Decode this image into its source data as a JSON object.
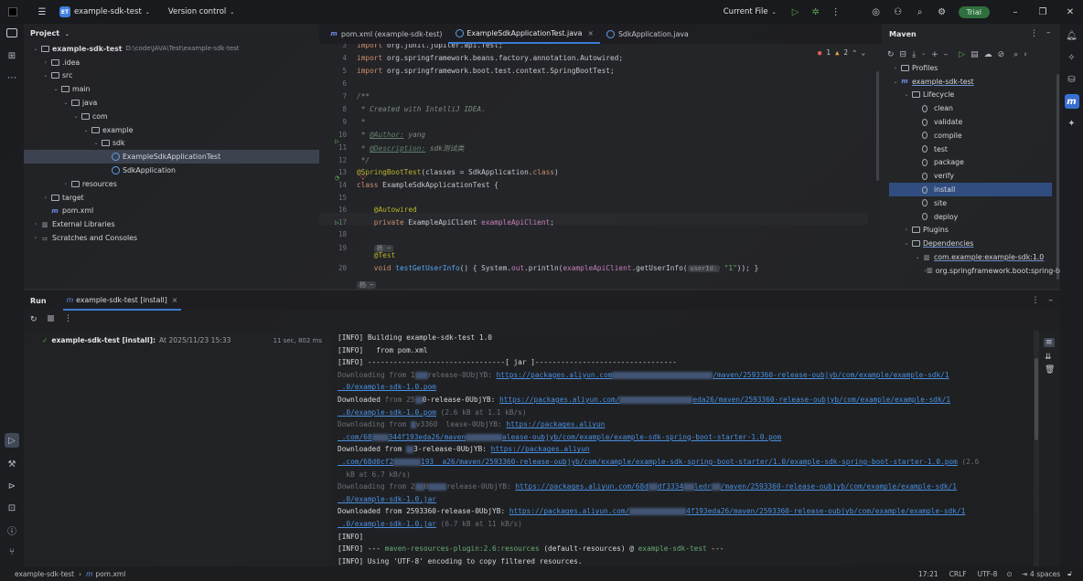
{
  "titlebar": {
    "project_badge": "ET",
    "project_name": "example-sdk-test",
    "vcs": "Version control",
    "run_config": "Current File",
    "trial": "Trial"
  },
  "project_panel": {
    "title": "Project",
    "items": [
      {
        "label": "example-sdk-test",
        "extra": "D:\\code\\JAVA\\Test\\example-sdk-test",
        "chev": "v",
        "icon": "folder",
        "bold": true
      },
      {
        "label": ".idea",
        "chev": ">",
        "icon": "folder"
      },
      {
        "label": "src",
        "chev": "v",
        "icon": "folder"
      },
      {
        "label": "main",
        "chev": "v",
        "icon": "folder"
      },
      {
        "label": "java",
        "chev": "v",
        "icon": "folder"
      },
      {
        "label": "com",
        "chev": "v",
        "icon": "folder"
      },
      {
        "label": "example",
        "chev": "v",
        "icon": "folder"
      },
      {
        "label": "sdk",
        "chev": "v",
        "icon": "folder"
      },
      {
        "label": "ExampleSdkApplicationTest",
        "chev": "",
        "icon": "java",
        "selected": true
      },
      {
        "label": "SdkApplication",
        "chev": "",
        "icon": "java"
      },
      {
        "label": "resources",
        "chev": ">",
        "icon": "folder"
      },
      {
        "label": "target",
        "chev": ">",
        "icon": "folder"
      },
      {
        "label": "pom.xml",
        "chev": "",
        "icon": "maven"
      },
      {
        "label": "External Libraries",
        "chev": ">",
        "icon": "lib"
      },
      {
        "label": "Scratches and Consoles",
        "chev": ">",
        "icon": "scratch"
      }
    ]
  },
  "editor": {
    "tabs": [
      {
        "label": "pom.xml (example-sdk-test)",
        "icon": "m"
      },
      {
        "label": "ExampleSdkApplicationTest.java",
        "icon": "java",
        "active": true,
        "close": "×"
      },
      {
        "label": "SdkApplication.java",
        "icon": "java"
      }
    ],
    "inspections": {
      "errors": "1",
      "warnings": "2"
    },
    "lines": [
      {
        "n": "3",
        "kw": "import ",
        "rest": "org.junit.jupiter.api.Test;"
      },
      {
        "n": "4",
        "kw": "import ",
        "rest": "org.springframework.beans.factory.annotation.Autowired;"
      },
      {
        "n": "5",
        "kw": "import ",
        "rest": "org.springframework.boot.test.context.SpringBootTest;"
      },
      {
        "n": "6",
        "kw": "",
        "rest": ""
      },
      {
        "n": "7",
        "kw": "",
        "rest": "/**",
        "cls": "cm"
      },
      {
        "n": "8",
        "kw": "",
        "rest": " * Created with IntelliJ IDEA.",
        "cls": "cm"
      },
      {
        "n": "9",
        "kw": "",
        "rest": " *",
        "cls": "cm"
      },
      {
        "n": "10",
        "kw": "",
        "rest": " * ",
        "cls": "cm",
        "tag": "@Author:",
        "tagval": " yang"
      },
      {
        "n": "11",
        "kw": "",
        "rest": " * ",
        "cls": "cm",
        "tag": "@Description:",
        "tagval": " sdk测试类"
      },
      {
        "n": "12",
        "kw": "",
        "rest": " */",
        "cls": "cm"
      },
      {
        "n": "13",
        "ann": "@SpringBootTest",
        "rest": "(classes = SdkApplication.",
        "kw2": "class",
        "rest2": ")"
      },
      {
        "n": "14",
        "kw": "class ",
        "rest": "ExampleSdkApplicationTest {"
      },
      {
        "n": "15",
        "kw": "",
        "rest": ""
      },
      {
        "n": "16",
        "ann": "    @Autowired",
        "rest": ""
      },
      {
        "n": "17",
        "kw": "    private ",
        "rest": "ExampleApiClient ",
        "fld": "exampleApiClient",
        "rest2": ";"
      },
      {
        "n": "18",
        "kw": "",
        "rest": ""
      },
      {
        "n": "19",
        "kw": "",
        "rest": "    ",
        "hintline": "杨 ~"
      },
      {
        "n": "",
        "ann": "    @Test",
        "rest": ""
      },
      {
        "n": "20",
        "kw": "    void ",
        "fn": "testGetUserInfo",
        "rest": "() { System.",
        "fld": "out",
        "rest2": ".println(",
        "fld2": "exampleApiClient",
        "rest3": ".getUserInfo(",
        "hint": "userId:",
        "str": " \"1\"",
        "rest4": ")); }"
      },
      {
        "n": "",
        "kw": "",
        "rest": "",
        "hintline": "杨 ~"
      }
    ]
  },
  "maven": {
    "title": "Maven",
    "items": [
      {
        "label": "Profiles",
        "chev": ">",
        "icon": "folder",
        "indent": 0
      },
      {
        "label": "example-sdk-test",
        "chev": "v",
        "icon": "m",
        "indent": 0,
        "underline": true
      },
      {
        "label": "Lifecycle",
        "chev": "v",
        "icon": "folder",
        "indent": 1
      },
      {
        "label": "clean",
        "icon": "gear",
        "indent": 2
      },
      {
        "label": "validate",
        "icon": "gear",
        "indent": 2
      },
      {
        "label": "compile",
        "icon": "gear",
        "indent": 2
      },
      {
        "label": "test",
        "icon": "gear",
        "indent": 2
      },
      {
        "label": "package",
        "icon": "gear",
        "indent": 2
      },
      {
        "label": "verify",
        "icon": "gear",
        "indent": 2
      },
      {
        "label": "install",
        "icon": "gear",
        "indent": 2,
        "selected": true
      },
      {
        "label": "site",
        "icon": "gear",
        "indent": 2
      },
      {
        "label": "deploy",
        "icon": "gear",
        "indent": 2
      },
      {
        "label": "Plugins",
        "chev": ">",
        "icon": "folder",
        "indent": 1
      },
      {
        "label": "Dependencies",
        "chev": "v",
        "icon": "folder",
        "indent": 1,
        "underline": true
      },
      {
        "label": "com.example:example-sdk:1.0",
        "chev": "v",
        "icon": "lib",
        "indent": 2,
        "underline": true
      },
      {
        "label": "org.springframework.boot:spring-b",
        "chev": ">",
        "icon": "lib",
        "indent": 3
      }
    ]
  },
  "run": {
    "title": "Run",
    "tab": "example-sdk-test [install]",
    "tree_item": "example-sdk-test [install]:",
    "tree_time": "At 2025/11/23 15:33",
    "duration": "11 sec, 802 ms",
    "console": [
      [
        {
          "t": "[INFO] Building example-sdk-test 1.0"
        }
      ],
      [
        {
          "t": "[INFO]   from pom.xml"
        }
      ],
      [
        {
          "t": "[INFO] --------------------------------[ jar ]---------------------------------"
        }
      ],
      [
        {
          "t": "Downloading from 1",
          "c": "dim"
        },
        {
          "b": 14
        },
        {
          "t": "release-0UbjYB: ",
          "c": "dim"
        },
        {
          "t": "https://packages.aliyun.com",
          "c": "lnk"
        },
        {
          "b": 110
        },
        {
          "t": "/maven/2593360-release-oubjyb/com/example/example-sdk/1",
          "c": "lnk"
        }
      ],
      [
        {
          "t": " .0/example-sdk-1.0.pom",
          "c": "lnk"
        }
      ],
      [
        {
          "t": "Downloaded "
        },
        {
          "t": "from 25",
          "c": "dim"
        },
        {
          "b": 8
        },
        {
          "t": "0-release-0UbjYB: "
        },
        {
          "t": "https://packages.aliyun.com/",
          "c": "lnk"
        },
        {
          "b": 80
        },
        {
          "t": "eda26/maven/2593360-release-oubjyb/com/example/example-sdk/1",
          "c": "lnk"
        }
      ],
      [
        {
          "t": " .0/example-sdk-1.0.pom",
          "c": "lnk"
        },
        {
          "t": " (2.6 kB at 1.1 kB/s)",
          "c": "dim"
        }
      ],
      [
        {
          "t": "Downloading from ",
          "c": "dim"
        },
        {
          "b": 6
        },
        {
          "t": "v3360  lease-0UbjYB: ",
          "c": "dim"
        },
        {
          "t": "https://packages.aliyun",
          "c": "lnk"
        }
      ],
      [
        {
          "t": " .com/68",
          "c": "lnk"
        },
        {
          "b": 18
        },
        {
          "t": "344f193eda26/maven",
          "c": "lnk"
        },
        {
          "b": 40
        },
        {
          "t": "alease-oubjyb/com/example/example-sdk-spring-boot-starter-1.0.pom",
          "c": "lnk"
        }
      ],
      [
        {
          "t": "Downloaded "
        },
        {
          "t": "from "
        },
        {
          "b": 8
        },
        {
          "t": "3-release-0UbjYB: "
        },
        {
          "t": "https://packages.aliyun",
          "c": "lnk"
        }
      ],
      [
        {
          "t": " .com/68d0cf2",
          "c": "lnk"
        },
        {
          "b": 30
        },
        {
          "t": "193  a26/maven/2593360-release-oubjyb/com/example/example-sdk-spring-boot-starter/1.0/example-sdk-spring-boot-starter-1.0.pom",
          "c": "lnk"
        },
        {
          "t": " (2.6",
          "c": "dim"
        }
      ],
      [
        {
          "t": "  kB at 6.7 kB/s)",
          "c": "dim"
        }
      ],
      [
        {
          "t": "Downloading from 2",
          "c": "dim"
        },
        {
          "b": 10
        },
        {
          "t": "0",
          "c": "dim"
        },
        {
          "b": 20
        },
        {
          "t": "release-0UbjYB: ",
          "c": "dim"
        },
        {
          "t": "https://packages.aliyun.com/68d",
          "c": "lnk"
        },
        {
          "b": 10
        },
        {
          "t": "df3334",
          "c": "lnk"
        },
        {
          "b": 12
        },
        {
          "t": "ledr",
          "c": "lnk"
        },
        {
          "b": 10
        },
        {
          "t": "/maven/2593360-release-oubjyb/com/example/example-sdk/1",
          "c": "lnk"
        }
      ],
      [
        {
          "t": " .0/example-sdk-1.0.jar",
          "c": "lnk"
        }
      ],
      [
        {
          "t": "Downloaded "
        },
        {
          "t": "from 2593360-release-0UbjYB: "
        },
        {
          "t": "https://packages.aliyun.com/",
          "c": "lnk"
        },
        {
          "b": 62
        },
        {
          "t": "4f193eda26/maven/2593360-release-oubjyb/com/example/example-sdk/1",
          "c": "lnk"
        }
      ],
      [
        {
          "t": " .0/example-sdk-1.0.jar",
          "c": "lnk"
        },
        {
          "t": " (6.7 kB at 11 kB/s)",
          "c": "dim"
        }
      ],
      [
        {
          "t": "[INFO]"
        }
      ],
      [
        {
          "t": "[INFO] --- "
        },
        {
          "t": "maven-resources-plugin:2.6:resources",
          "c": "grn"
        },
        {
          "t": " (default-resources) @ "
        },
        {
          "t": "example-sdk-test",
          "c": "grn"
        },
        {
          "t": " ---"
        }
      ],
      [
        {
          "t": "[INFO] Using 'UTF-8' encoding to copy filtered resources."
        }
      ]
    ]
  },
  "status": {
    "breadcrumb_project": "example-sdk-test",
    "breadcrumb_file": "pom.xml",
    "position": "17:21",
    "line_sep": "CRLF",
    "encoding": "UTF-8",
    "indent": "4 spaces"
  },
  "colors": {
    "accent": "#3a7bd5",
    "run_green": "#57a64a",
    "error": "#e55b5b",
    "warning": "#e8a33d"
  }
}
